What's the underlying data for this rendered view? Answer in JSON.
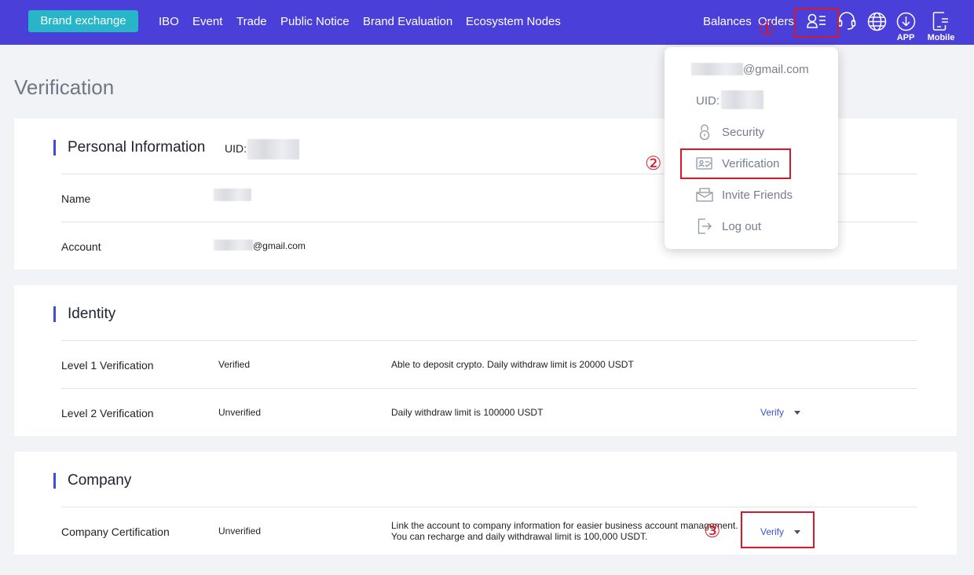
{
  "nav": {
    "brand": "Brand exchange",
    "links": [
      "IBO",
      "Event",
      "Trade",
      "Public Notice",
      "Brand Evaluation",
      "Ecosystem Nodes"
    ],
    "balances": "Balances",
    "orders": "Orders",
    "app_label": "APP",
    "mobile_label": "Mobile"
  },
  "annotations": [
    "①",
    "②",
    "③"
  ],
  "page_title": "Verification",
  "personal": {
    "heading": "Personal Information",
    "uid_label": "UID:",
    "rows": [
      {
        "label": "Name",
        "value": ""
      },
      {
        "label": "Account",
        "value_suffix": "@gmail.com"
      }
    ]
  },
  "identity": {
    "heading": "Identity",
    "rows": [
      {
        "label": "Level 1 Verification",
        "status": "Verified",
        "desc": "Able to deposit crypto. Daily withdraw limit is 20000 USDT"
      },
      {
        "label": "Level 2 Verification",
        "status": "Unverified",
        "desc": "Daily withdraw limit is 100000 USDT",
        "action": "Verify"
      }
    ]
  },
  "company": {
    "heading": "Company",
    "row": {
      "label": "Company Certification",
      "status": "Unverified",
      "desc_line1": "Link the account to company information for easier business account management.",
      "desc_line2": "You can recharge and daily withdrawal limit is 100,000 USDT.",
      "action": "Verify"
    }
  },
  "dropdown": {
    "email_suffix": "@gmail.com",
    "uid_label": "UID:",
    "items": [
      {
        "label": "Security",
        "icon": "lock-icon"
      },
      {
        "label": "Verification",
        "icon": "id-card-icon"
      },
      {
        "label": "Invite Friends",
        "icon": "envelope-icon"
      },
      {
        "label": "Log out",
        "icon": "logout-icon"
      }
    ]
  },
  "colors": {
    "nav_bg": "#4a3fd9",
    "brand_btn": "#26b6c8",
    "accent": "#3d4fd6",
    "annotation_red": "#d6182b"
  }
}
